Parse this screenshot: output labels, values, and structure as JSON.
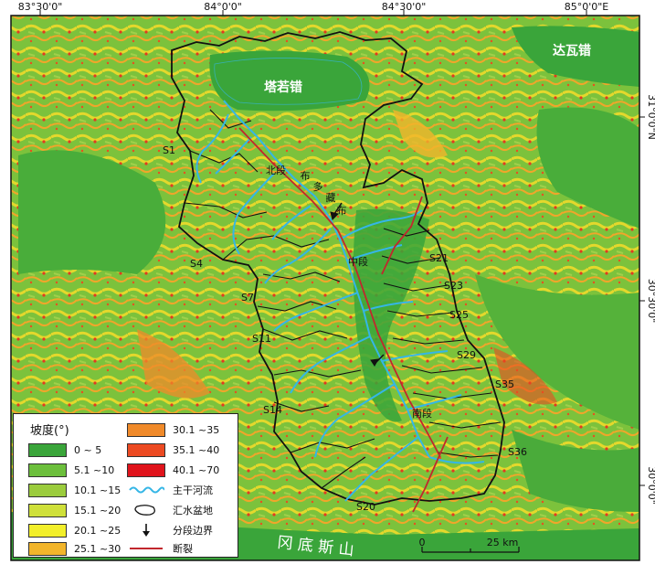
{
  "map": {
    "lon_labels": [
      "83°30'0\"",
      "84°0'0\"",
      "84°30'0\"",
      "85°0'0\"E"
    ],
    "lat_labels": [
      "31°0'0\"N",
      "30°30'0\"",
      "30°0'0\""
    ],
    "place_labels": {
      "lake_tarouco": "塔若错",
      "lake_dawa": "达瓦错",
      "mountain": "冈 底 斯 山",
      "segment_north": "北段",
      "segment_middle": "中段",
      "segment_south": "南段",
      "river_char_1": "布",
      "river_char_2": "多",
      "river_char_3": "藏",
      "river_char_4": "布"
    },
    "basin_labels": [
      "S1",
      "S4",
      "S7",
      "S11",
      "S14",
      "S20",
      "S21",
      "S23",
      "S25",
      "S29",
      "S35",
      "S36"
    ],
    "scale": {
      "zero": "0",
      "distance": "25 km"
    }
  },
  "legend": {
    "title": "坡度(°)",
    "slope_classes": [
      {
        "label": "0 ~ 5",
        "color": "#3aa53a"
      },
      {
        "label": "5.1 ~10",
        "color": "#6cbf3c"
      },
      {
        "label": "10.1 ~15",
        "color": "#9bcc3d"
      },
      {
        "label": "15.1 ~20",
        "color": "#cfe03a"
      },
      {
        "label": "20.1 ~25",
        "color": "#f2ef2b"
      },
      {
        "label": "25.1 ~30",
        "color": "#f2b52b"
      },
      {
        "label": "30.1 ~35",
        "color": "#f08a2a"
      },
      {
        "label": "35.1 ~40",
        "color": "#ec4a22"
      },
      {
        "label": "40.1 ~70",
        "color": "#e0141c"
      }
    ],
    "symbols": {
      "river": "主干河流",
      "basin": "汇水盆地",
      "boundary": "分段边界",
      "fault": "断裂"
    }
  },
  "colors": {
    "river": "#35b6e6",
    "fault": "#c1272d",
    "basin_outline": "#111111"
  }
}
